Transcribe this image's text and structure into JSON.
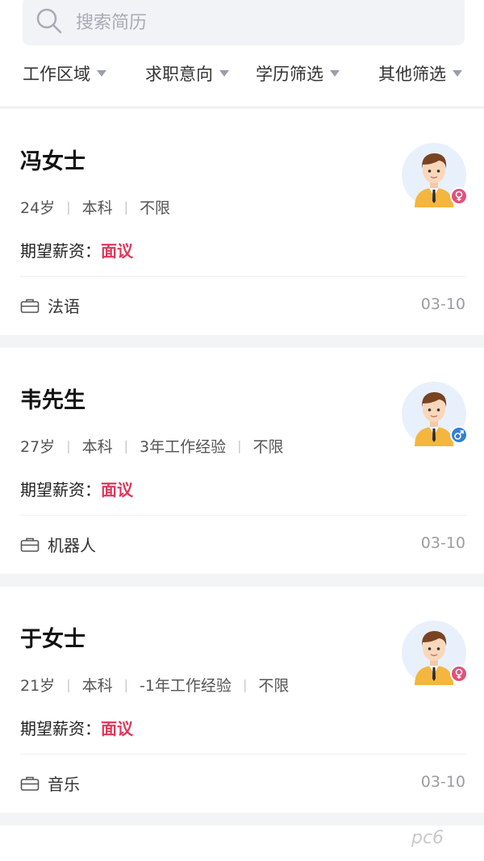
{
  "search": {
    "placeholder": "搜索简历"
  },
  "filters": [
    {
      "label": "工作区域"
    },
    {
      "label": "求职意向"
    },
    {
      "label": "学历筛选"
    },
    {
      "label": "其他筛选"
    }
  ],
  "salary_label": "期望薪资：",
  "colors": {
    "accent": "#e0365a",
    "female": "#e0517a",
    "male": "#2f7fd8",
    "divider": "#efeff2"
  },
  "cards": [
    {
      "name": "冯女士",
      "age": "24岁",
      "edu": "本科",
      "exp": "",
      "extra": "不限",
      "salary": "面议",
      "job": "法语",
      "date": "03-10",
      "gender": "female"
    },
    {
      "name": "韦先生",
      "age": "27岁",
      "edu": "本科",
      "exp": "3年工作经验",
      "extra": "不限",
      "salary": "面议",
      "job": "机器人",
      "date": "03-10",
      "gender": "male"
    },
    {
      "name": "于女士",
      "age": "21岁",
      "edu": "本科",
      "exp": "-1年工作经验",
      "extra": "不限",
      "salary": "面议",
      "job": "音乐",
      "date": "03-10",
      "gender": "female"
    }
  ],
  "watermark": "pc6"
}
